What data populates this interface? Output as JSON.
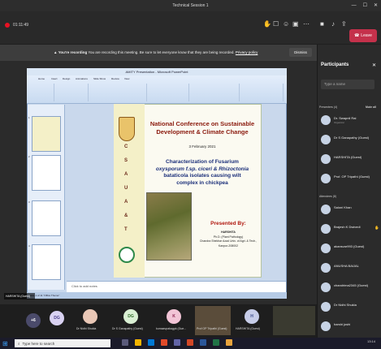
{
  "window": {
    "title": "Technical Session 1",
    "min": "—",
    "max": "☐",
    "close": "✕"
  },
  "toolbar": {
    "elapsed": "01:11:49",
    "leave_label": "Leave",
    "icons": [
      "raise-hand-icon",
      "chat-icon",
      "participants-icon",
      "rooms-icon",
      "more-icon",
      "camera-icon",
      "mic-icon",
      "share-icon"
    ]
  },
  "banner": {
    "prefix": "You're recording",
    "text": "You are recording this meeting. Be sure to let everyone know that they are being recorded.",
    "link": "Privacy policy",
    "dismiss": "Dismiss"
  },
  "powerpoint": {
    "title": "AMITY Presentation - Microsoft PowerPoint",
    "tabs": [
      "Home",
      "Insert",
      "Design",
      "Animations",
      "Slide Show",
      "Review",
      "View"
    ],
    "notes_placeholder": "Click to add notes",
    "status": "Slide 1 of 11   \"Office Theme\"",
    "thumbs": [
      "1",
      "2",
      "3",
      "4"
    ]
  },
  "slide": {
    "conference": "National Conference on Sustainable Development & Climate Change",
    "date": "3 February 2021",
    "vertical": [
      "C",
      "S",
      "A",
      "U",
      "A",
      "&",
      "T"
    ],
    "char_line1": "Characterization of Fusarium",
    "char_line2": "oxysporum f.sp. ciceri & Rhizoctonia",
    "char_line3": "bataticola isolates causing wilt",
    "char_line4": "complex in chickpea",
    "presented_by": "Presented By:",
    "presenter": "HARSHITA",
    "degree": "Ph.D. (Plant Pathology)",
    "university": "Chandra Shekhar Azad Univ. of Agri. & Tech., Kanpur-208002"
  },
  "presenter_tile": {
    "name": "HARSHITA (Guest)"
  },
  "tiles": [
    {
      "initials": "+6",
      "name": ""
    },
    {
      "initials": "DG",
      "name": "Dr Gnapathy (Guest)"
    },
    {
      "initials": "DN",
      "name": "Dr Nidhi Shukla"
    },
    {
      "initials": "DG",
      "name": "Dr S Ganapathy (Guest)"
    },
    {
      "initials": "K",
      "name": "kumaavpakagpk (Gue..."
    },
    {
      "initials": "",
      "name": "Prof OP Tripathi (Guest)"
    },
    {
      "initials": "H",
      "name": "HARSHITA (Guest)"
    }
  ],
  "participants": {
    "title": "Participants",
    "search_placeholder": "Type a name",
    "presenters_header": "Presenters (4)",
    "mute_all": "Mute all",
    "presenters": [
      {
        "name": "Dr. Swapnil Rai",
        "role": "Organizer"
      },
      {
        "name": "Dr S Ganapathy (Guest)",
        "role": ""
      },
      {
        "name": "HARSHITA (Guest)",
        "role": ""
      },
      {
        "name": "Prof. OP Tripathi (Guest)",
        "role": ""
      }
    ],
    "attendees_header": "Attendees (8)",
    "attendees": [
      {
        "name": "Saloni Khan"
      },
      {
        "name": "Brajesh K Dwivedi"
      },
      {
        "name": "akansvar993 (Guest)"
      },
      {
        "name": "ANUSHA BAIJAL"
      },
      {
        "name": "chandrima2345 (Guest)"
      },
      {
        "name": "Dr Nidhi Shukla"
      },
      {
        "name": "harshi joshi"
      }
    ]
  },
  "taskbar": {
    "search_placeholder": "Type here to search",
    "tray_time": "13:14"
  },
  "colors": {
    "leave": "#c4314b",
    "accent": "#6264a7",
    "record": "#e81123"
  }
}
